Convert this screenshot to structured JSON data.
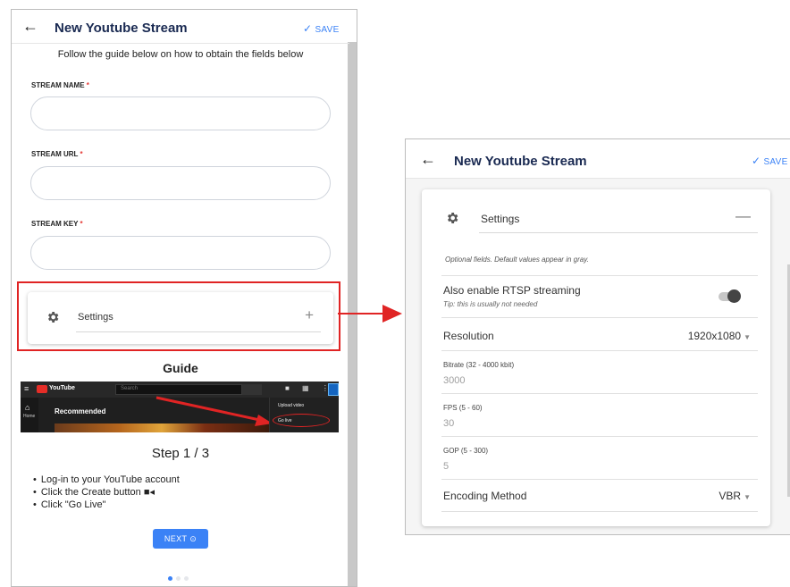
{
  "left": {
    "header": {
      "back_icon": "arrow-left-icon",
      "title": "New Youtube Stream",
      "save_label": "SAVE"
    },
    "intro": "Follow the guide below on how to obtain the fields below",
    "fields": [
      {
        "label": "STREAM NAME",
        "required_mark": "*",
        "value": ""
      },
      {
        "label": "STREAM URL",
        "required_mark": "*",
        "value": ""
      },
      {
        "label": "STREAM KEY",
        "required_mark": "*",
        "value": ""
      }
    ],
    "settings": {
      "label": "Settings",
      "icon": "gear-icon",
      "toggle": "+"
    },
    "guide": {
      "heading": "Guide",
      "screenshot": {
        "logo_text": "YouTube",
        "search_placeholder": "Search",
        "home_label": "Home",
        "recommended_label": "Recommended",
        "menu_items": [
          "Upload video",
          "Go live"
        ]
      },
      "step_title": "Step 1 / 3",
      "steps": [
        "Log-in to your YouTube account",
        "Click the Create button",
        "Click \"Go Live\""
      ],
      "next_label": "NEXT",
      "dots_total": 3,
      "dots_active": 1
    }
  },
  "right": {
    "header": {
      "back_icon": "arrow-left-icon",
      "title": "New Youtube Stream",
      "save_label": "SAVE"
    },
    "settings_title": "Settings",
    "collapse_symbol": "—",
    "note": "Optional fields. Default values appear in gray.",
    "rtsp": {
      "title": "Also enable RTSP streaming",
      "tip": "Tip: this is usually not needed",
      "enabled": false
    },
    "resolution": {
      "label": "Resolution",
      "value": "1920x1080"
    },
    "bitrate": {
      "label": "Bitrate (32 - 4000 kbit)",
      "value": "3000"
    },
    "fps": {
      "label": "FPS (5 - 60)",
      "value": "30"
    },
    "gop": {
      "label": "GOP (5 - 300)",
      "value": "5"
    },
    "encoding": {
      "label": "Encoding Method",
      "value": "VBR"
    }
  },
  "colors": {
    "accent": "#3b82f6",
    "highlight": "#e02424",
    "title": "#1a2a52",
    "required": "#e53935"
  }
}
